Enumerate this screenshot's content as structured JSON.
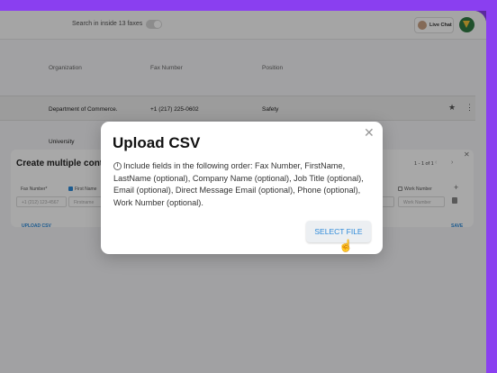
{
  "topbar": {
    "search_label": "Search in inside 13 faxes",
    "live_chat": "Live Chat"
  },
  "table": {
    "columns": [
      "Organization",
      "Fax Number",
      "Position"
    ],
    "rows": [
      {
        "organization": "Department of Commerce.",
        "fax": "+1 (217) 225-0602",
        "position": "Safety"
      },
      {
        "organization": "University",
        "fax": "",
        "position": ""
      }
    ]
  },
  "panel": {
    "title": "Create multiple cont",
    "pager": "1 - 1 of 1",
    "fields": {
      "fax_label": "Fax Number*",
      "first_name_label": "First Name",
      "work_number_label": "Work Number",
      "fax_placeholder": "+1 (212) 123-4567",
      "first_name_placeholder": "Firstname",
      "work_number_placeholder": "Work Number"
    },
    "upload_csv": "UPLOAD CSV",
    "save": "SAVE"
  },
  "modal": {
    "title": "Upload CSV",
    "body": "Include fields in the following order: Fax Number, FirstName, LastName (optional), Company Name (optional), Job Title (optional), Email (optional), Direct Message Email (optional), Phone (optional), Work Number (optional).",
    "button": "SELECT FILE"
  },
  "colors": {
    "brand_purple": "#8a3ff0",
    "accent_blue": "#2d8ad9"
  }
}
